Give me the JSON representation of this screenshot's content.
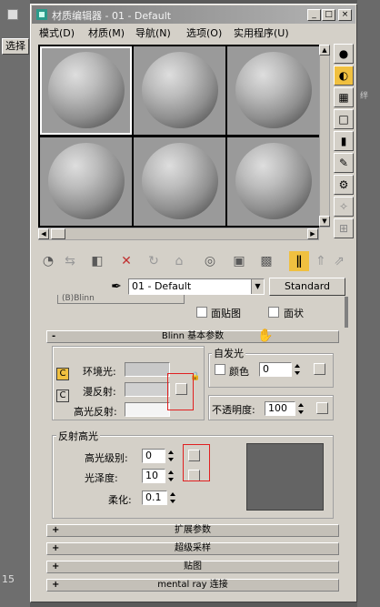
{
  "background": {
    "left_button_label": "选择",
    "right_text": "绊",
    "bottom_left": "15"
  },
  "window": {
    "title": "材质编辑器 - 01 - Default",
    "buttons": [
      "_",
      "□",
      "×"
    ]
  },
  "menu": [
    "模式(D)",
    "材质(M)",
    "导航(N)",
    "选项(O)",
    "实用程序(U)"
  ],
  "material": {
    "name": "01 - Default",
    "type_button": "Standard"
  },
  "shader_row": {
    "shader_value": "(B)Blinn",
    "facemap_label": "面贴图",
    "faceted_label": "面状"
  },
  "blinn_basic": {
    "rollout_title": "Blinn 基本参数",
    "ambient_label": "环境光:",
    "diffuse_label": "漫反射:",
    "specular_label": "高光反射:",
    "self_illum": {
      "group": "自发光",
      "color_label": "颜色",
      "value": "0"
    },
    "opacity": {
      "label": "不透明度:",
      "value": "100"
    },
    "specular_highlights": {
      "group": "反射高光",
      "level_label": "高光级别:",
      "level_value": "0",
      "gloss_label": "光泽度:",
      "gloss_value": "10",
      "soften_label": "柔化:",
      "soften_value": "0.1"
    }
  },
  "rollouts": [
    {
      "sign": "+",
      "title": "扩展参数"
    },
    {
      "sign": "+",
      "title": "超级采样"
    },
    {
      "sign": "+",
      "title": "贴图"
    },
    {
      "sign": "+",
      "title": "mental ray 连接"
    }
  ],
  "rollout_minus": "-",
  "colors": {
    "title_gradient_start": "#7d7d7d",
    "panel": "#d4d0c8",
    "highlight_preview": "#646464",
    "selected_tool": "#f0c040"
  }
}
